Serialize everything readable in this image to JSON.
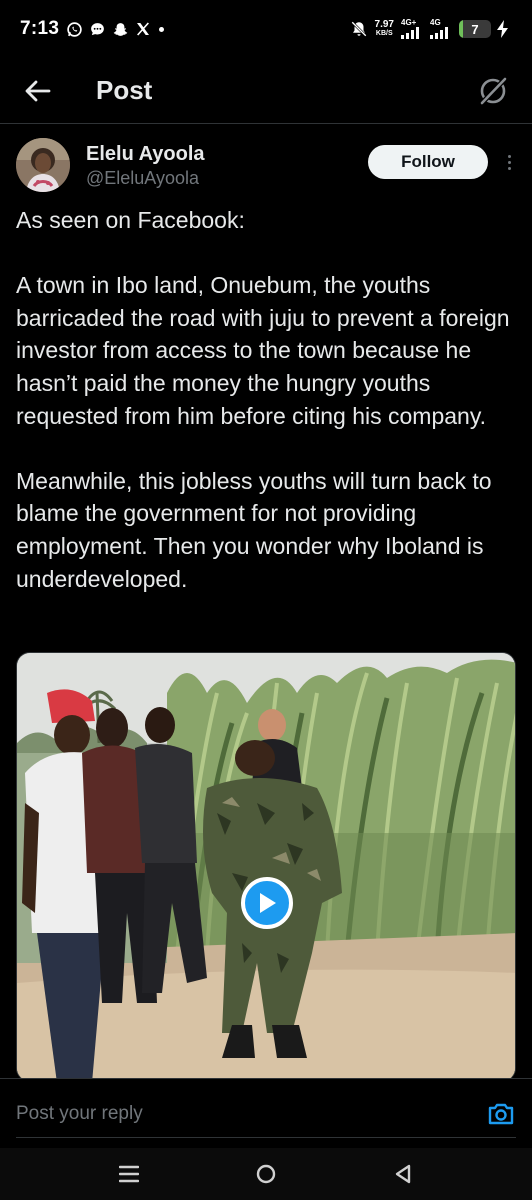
{
  "status_bar": {
    "time": "7:13",
    "left_icons": [
      "whatsapp-icon",
      "chat-bubble-icon",
      "snapchat-icon",
      "x-icon",
      "dot-icon"
    ],
    "net_speed_value": "7.97",
    "net_speed_unit": "KB/S",
    "signal1_label": "4G+",
    "signal2_label": "4G",
    "battery_level": "7",
    "battery_fraction": 0.07,
    "charging": true
  },
  "header": {
    "title": "Post",
    "back_icon": "arrow-left-icon",
    "grok_icon": "grok-icon"
  },
  "author": {
    "display_name": "Elelu Ayoola",
    "handle": "@EleluAyoola",
    "follow_label": "Follow"
  },
  "tweet": {
    "text": "As seen on Facebook:\n\nA town in Ibo land, Onuebum, the youths barricaded the road with juju to prevent a foreign investor from access to the town because he hasn’t paid the money the hungry youths requested from him before citing his company.\n\nMeanwhile, this jobless youths will turn back to blame the government for not providing employment. Then you wonder why Iboland is underdeveloped."
  },
  "media": {
    "type": "video",
    "play_icon": "play-icon"
  },
  "reply": {
    "placeholder": "Post your reply",
    "camera_icon": "camera-icon"
  },
  "android_nav": {
    "items": [
      "menu-icon",
      "home-circle-icon",
      "back-triangle-icon"
    ]
  },
  "colors": {
    "background": "#000000",
    "text": "#e7e9ea",
    "muted": "#71767b",
    "accent": "#1d9bf0",
    "border": "#2f3336"
  }
}
